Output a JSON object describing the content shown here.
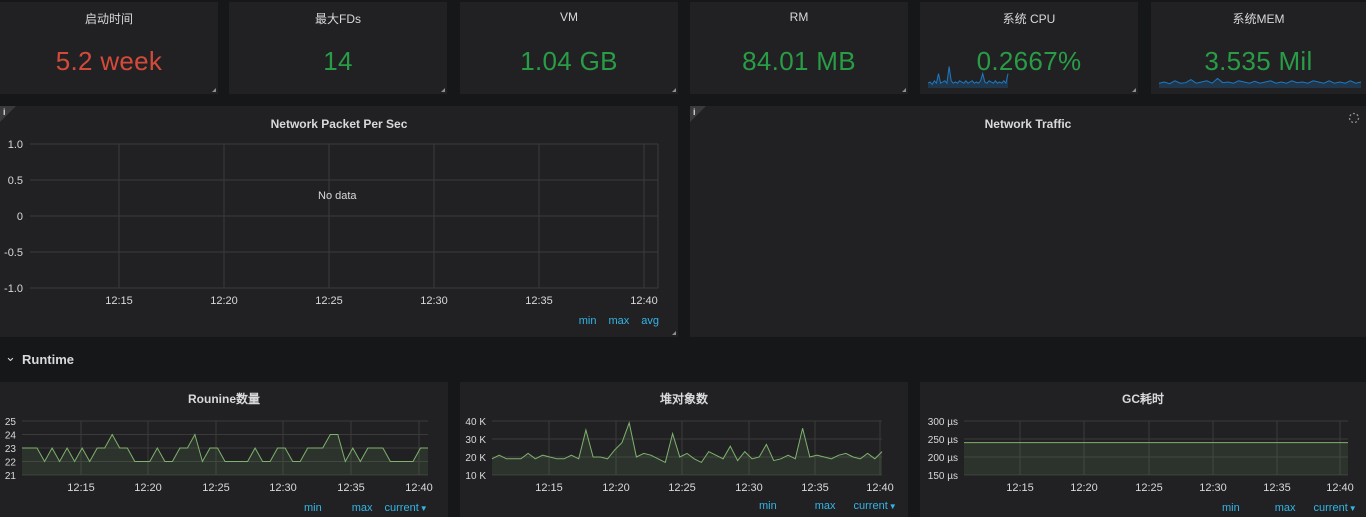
{
  "stats": [
    {
      "title": "启动时间",
      "value": "5.2 week",
      "color": "#d44a3a"
    },
    {
      "title": "最大FDs",
      "value": "14",
      "color": "#299c46"
    },
    {
      "title": "VM",
      "value": "1.04 GB",
      "color": "#299c46"
    },
    {
      "title": "RM",
      "value": "84.01 MB",
      "color": "#299c46"
    },
    {
      "title": "系统 CPU",
      "value": "0.2667%",
      "color": "#299c46",
      "spark": [
        0.2,
        0.25,
        0.15,
        0.3,
        0.2,
        0.6,
        0.2,
        0.25,
        0.3,
        0.2,
        0.9,
        0.3,
        0.2,
        0.25,
        0.2,
        0.3,
        0.25,
        0.2,
        0.3,
        0.2,
        0.25,
        0.3,
        0.2,
        0.25,
        0.2,
        0.3,
        0.6,
        0.25,
        0.2,
        0.3,
        0.25,
        0.2,
        0.3,
        0.2,
        0.25,
        0.2,
        0.3,
        0.2,
        0.6
      ]
    },
    {
      "title": "系统MEM",
      "value": "3.535 Mil",
      "color": "#299c46",
      "spark": [
        0.2,
        0.25,
        0.18,
        0.3,
        0.2,
        0.22,
        0.35,
        0.2,
        0.25,
        0.3,
        0.2,
        0.4,
        0.22,
        0.25,
        0.2,
        0.3,
        0.25,
        0.2,
        0.28,
        0.2,
        0.25,
        0.3,
        0.2,
        0.25,
        0.2,
        0.3,
        0.22,
        0.25,
        0.2,
        0.3,
        0.25,
        0.2,
        0.3,
        0.2,
        0.25,
        0.2,
        0.3,
        0.2,
        0.25
      ]
    }
  ],
  "network_packet": {
    "title": "Network Packet Per Sec",
    "no_data": "No data",
    "y_ticks": [
      "1.0",
      "0.5",
      "0",
      "-0.5",
      "-1.0"
    ],
    "x_ticks": [
      "12:15",
      "12:20",
      "12:25",
      "12:30",
      "12:35",
      "12:40"
    ],
    "legend": [
      "min",
      "max",
      "avg"
    ]
  },
  "network_traffic": {
    "title": "Network Traffic"
  },
  "row": {
    "title": "Runtime"
  },
  "charts": [
    {
      "title": "Rounine数量",
      "y_ticks": [
        "25",
        "24",
        "23",
        "22",
        "21"
      ],
      "x_ticks": [
        "12:15",
        "12:20",
        "12:25",
        "12:30",
        "12:35",
        "12:40"
      ],
      "legend": [
        "min",
        "max",
        "current"
      ],
      "chart_data": {
        "type": "area",
        "ylim": [
          21,
          25
        ],
        "values": [
          23,
          23,
          23,
          22,
          23,
          22,
          23,
          22,
          23,
          22,
          23,
          23,
          24,
          23,
          23,
          22,
          22,
          22,
          23,
          22,
          22,
          23,
          23,
          24,
          22,
          23,
          23,
          22,
          22,
          22,
          22,
          23,
          22,
          22,
          23,
          23,
          22,
          22,
          23,
          23,
          23,
          24,
          24,
          22,
          23,
          22,
          23,
          23,
          23,
          22,
          22,
          22,
          22,
          23,
          23
        ]
      }
    },
    {
      "title": "堆对象数",
      "y_ticks": [
        "40 K",
        "30 K",
        "20 K",
        "10 K"
      ],
      "x_ticks": [
        "12:15",
        "12:20",
        "12:25",
        "12:30",
        "12:35",
        "12:40"
      ],
      "legend": [
        "min",
        "max",
        "current"
      ],
      "chart_data": {
        "type": "area",
        "ylim": [
          10000,
          40000
        ],
        "values": [
          19000,
          21000,
          19000,
          19000,
          19000,
          22000,
          19000,
          21000,
          20000,
          19000,
          19000,
          21000,
          19000,
          35000,
          20000,
          20000,
          19000,
          24000,
          28000,
          39000,
          20000,
          22000,
          21000,
          19000,
          17000,
          33000,
          20000,
          22000,
          19000,
          17000,
          23000,
          21000,
          19000,
          26000,
          18000,
          23000,
          19000,
          20000,
          27000,
          18000,
          19000,
          21000,
          19000,
          36000,
          20000,
          21000,
          20000,
          19000,
          21000,
          22000,
          20000,
          19000,
          22000,
          19000,
          23000
        ]
      }
    },
    {
      "title": "GC耗时",
      "y_ticks": [
        "300 µs",
        "250 µs",
        "200 µs",
        "150 µs"
      ],
      "x_ticks": [
        "12:15",
        "12:20",
        "12:25",
        "12:30",
        "12:35",
        "12:40"
      ],
      "legend": [
        "min",
        "max",
        "current"
      ],
      "chart_data": {
        "type": "line",
        "ylim": [
          150,
          300
        ],
        "values": [
          240,
          240,
          240,
          240,
          240,
          240,
          240,
          240,
          240,
          240,
          240,
          240,
          240,
          240,
          240,
          240,
          240,
          240,
          240,
          240
        ]
      }
    }
  ],
  "colors": {
    "series": "#7eb26d",
    "legend": "#33b5e5",
    "grid": "#3a3a3a"
  }
}
